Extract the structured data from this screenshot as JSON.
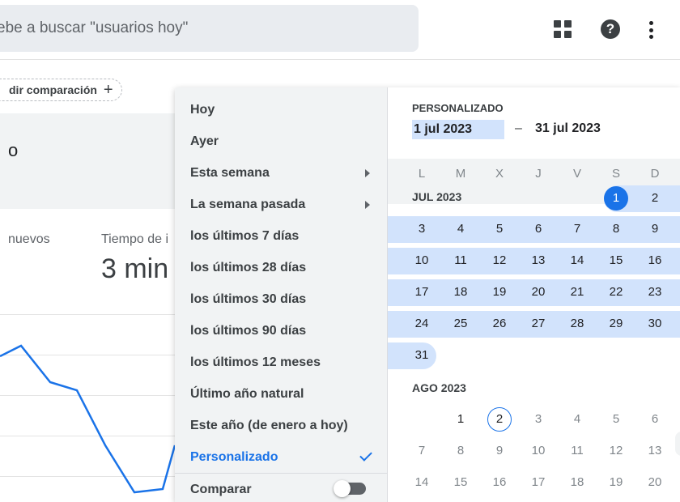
{
  "search": {
    "text": "ebe a buscar \"usuarios hoy\""
  },
  "background": {
    "compare_label": "dir comparación",
    "card_title": "o",
    "metric_1_label": "nuevos",
    "metric_2_label": "Tiempo de i",
    "metric_2_value": "3 min"
  },
  "menu": {
    "items": [
      {
        "label": "Hoy"
      },
      {
        "label": "Ayer"
      },
      {
        "label": "Esta semana"
      },
      {
        "label": "La semana pasada"
      },
      {
        "label": "los últimos 7 días"
      },
      {
        "label": "los últimos 28 días"
      },
      {
        "label": "los últimos 30 días"
      },
      {
        "label": "los últimos 90 días"
      },
      {
        "label": "los últimos 12 meses"
      },
      {
        "label": "Último año natural"
      },
      {
        "label": "Este año (de enero a hoy)"
      },
      {
        "label": "Personalizado"
      }
    ],
    "compare_label": "Comparar"
  },
  "calendar": {
    "mode_label": "PERSONALIZADO",
    "start_date": "1 jul 2023",
    "dash": "–",
    "end_date": "31 jul 2023",
    "weekdays": [
      "L",
      "M",
      "X",
      "J",
      "V",
      "S",
      "D"
    ],
    "months": [
      {
        "label": "JUL 2023",
        "days": [
          "1",
          "2",
          "3",
          "4",
          "5",
          "6",
          "7",
          "8",
          "9",
          "10",
          "11",
          "12",
          "13",
          "14",
          "15",
          "16",
          "17",
          "18",
          "19",
          "20",
          "21",
          "22",
          "23",
          "24",
          "25",
          "26",
          "27",
          "28",
          "29",
          "30",
          "31"
        ]
      },
      {
        "label": "AGO 2023",
        "days": [
          "1",
          "2",
          "3",
          "4",
          "5",
          "6",
          "7",
          "8",
          "9",
          "10",
          "11",
          "12",
          "13",
          "14",
          "15",
          "16",
          "17",
          "18",
          "19",
          "20"
        ]
      }
    ]
  },
  "colors": {
    "accent": "#1a73e8",
    "range": "#d2e3fc",
    "menu_bg": "#f1f3f4"
  }
}
